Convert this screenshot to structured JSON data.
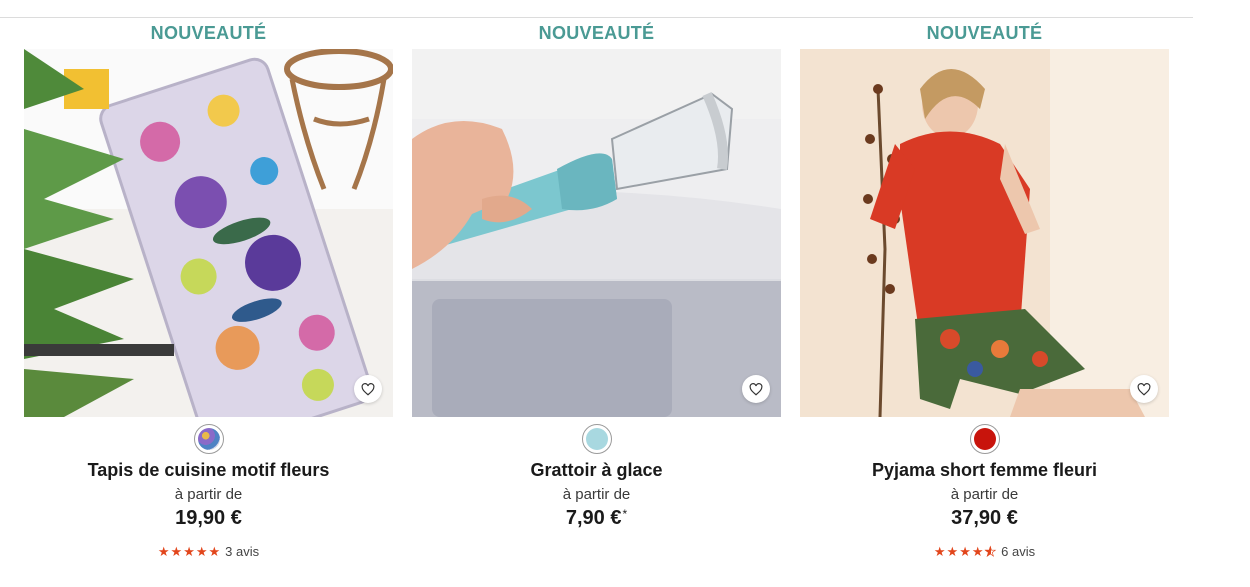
{
  "products": [
    {
      "badge": "NOUVEAUTÉ",
      "name": "Tapis de cuisine motif fleurs",
      "from_label": "à partir de",
      "price": "19,90 €",
      "price_note": "",
      "swatch_color": "#6b7fb5",
      "rating": 5,
      "reviews": "3 avis"
    },
    {
      "badge": "NOUVEAUTÉ",
      "name": "Grattoir à glace",
      "from_label": "à partir de",
      "price": "7,90 €",
      "price_note": "*",
      "swatch_color": "#a8d8e0"
    },
    {
      "badge": "NOUVEAUTÉ",
      "name": "Pyjama short femme fleuri",
      "from_label": "à partir de",
      "price": "37,90 €",
      "price_note": "",
      "swatch_color": "#c8140c",
      "rating": 4.5,
      "reviews": "6 avis"
    }
  ],
  "icons": {
    "favorite": "heart-outline-icon",
    "star": "star-icon"
  },
  "colors": {
    "badge": "#4a9a94",
    "star": "#e2461c"
  }
}
